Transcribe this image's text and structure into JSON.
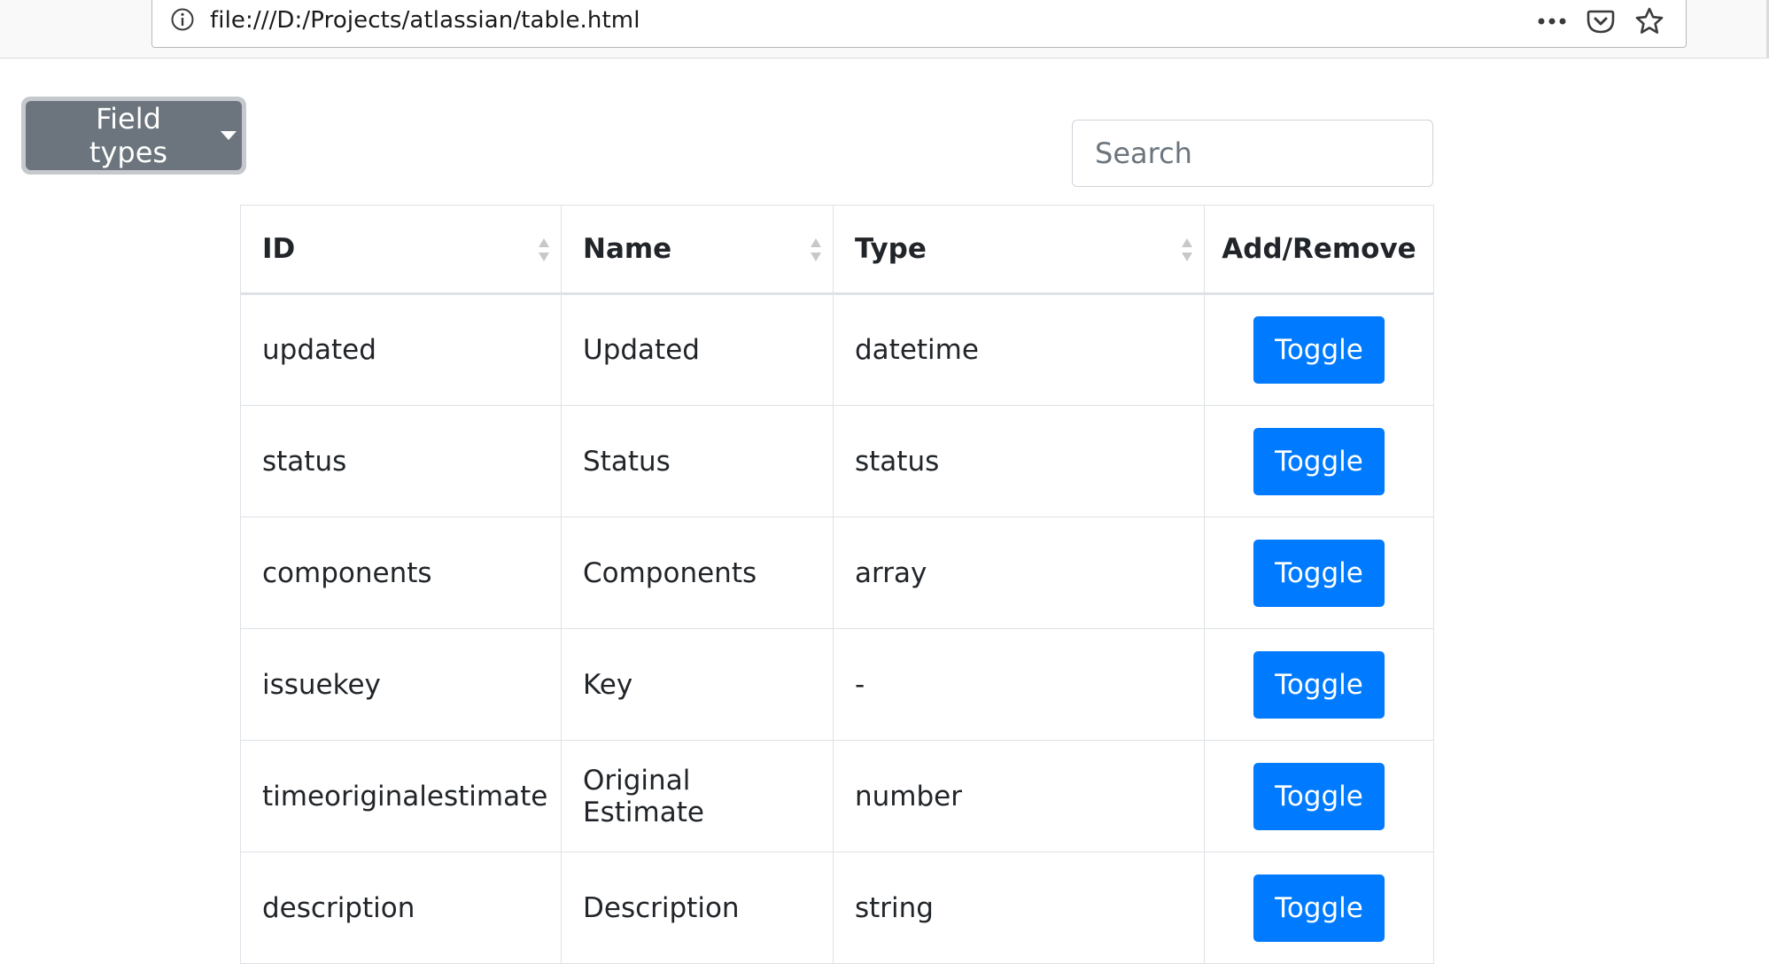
{
  "browser": {
    "url": "file:///D:/Projects/atlassian/table.html",
    "icons": [
      "info-icon",
      "more-actions-icon",
      "pocket-icon",
      "bookmark-star-icon"
    ]
  },
  "toolbar": {
    "dropdown_label": "Field types",
    "search_placeholder": "Search"
  },
  "table": {
    "headers": {
      "id": "ID",
      "name": "Name",
      "type": "Type",
      "action": "Add/Remove"
    },
    "rows": [
      {
        "id": "updated",
        "name": "Updated",
        "type": "datetime",
        "action": "Toggle"
      },
      {
        "id": "status",
        "name": "Status",
        "type": "status",
        "action": "Toggle"
      },
      {
        "id": "components",
        "name": "Components",
        "type": "array",
        "action": "Toggle"
      },
      {
        "id": "issuekey",
        "name": "Key",
        "type": "-",
        "action": "Toggle"
      },
      {
        "id": "timeoriginalestimate",
        "name": "Original Estimate",
        "type": "number",
        "action": "Toggle"
      },
      {
        "id": "description",
        "name": "Description",
        "type": "string",
        "action": "Toggle"
      }
    ]
  },
  "colors": {
    "primary": "#007bff",
    "secondary": "#6c757d",
    "border": "#dee2e6",
    "text": "#212529"
  }
}
